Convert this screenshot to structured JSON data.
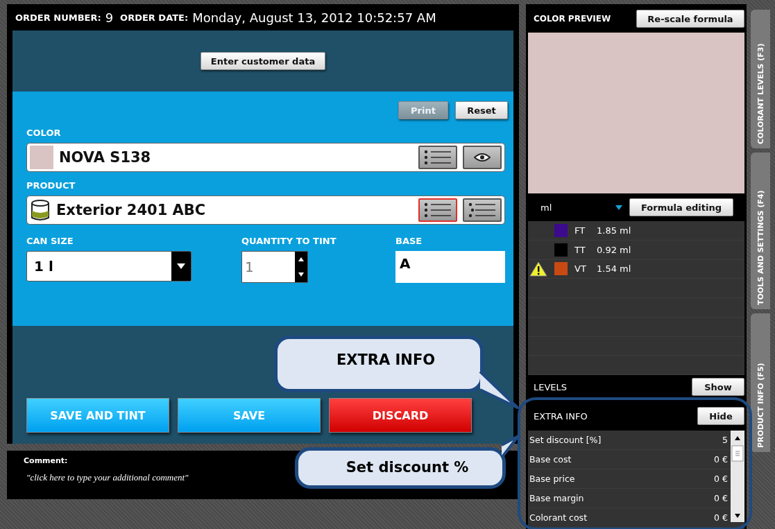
{
  "header": {
    "order_number_label": "ORDER NUMBER:",
    "order_number": "9",
    "order_date_label": "ORDER DATE:",
    "order_date": "Monday, August 13, 2012 10:52:57 AM"
  },
  "customer_button": "Enter customer data",
  "top_buttons": [
    {
      "label": "Print",
      "disabled": true
    },
    {
      "label": "Reset",
      "disabled": false
    }
  ],
  "color": {
    "label": "COLOR",
    "value": "NOVA S138",
    "actions": [
      {
        "kind": "list",
        "highlighted": false
      },
      {
        "kind": "eye",
        "highlighted": false
      }
    ]
  },
  "product": {
    "label": "PRODUCT",
    "value": "Exterior 2401 ABC",
    "actions": [
      {
        "kind": "list",
        "highlighted": true
      },
      {
        "kind": "detail",
        "highlighted": false
      }
    ]
  },
  "can_size": {
    "label": "CAN SIZE",
    "value": "1 l"
  },
  "quantity": {
    "label": "QUANTITY TO TINT",
    "value": "1"
  },
  "base": {
    "label": "BASE",
    "value": "A"
  },
  "actions": [
    {
      "label": "SAVE AND TINT",
      "kind": "primary"
    },
    {
      "label": "SAVE",
      "kind": "primary"
    },
    {
      "label": "DISCARD",
      "kind": "danger"
    }
  ],
  "comment": {
    "label": "Comment:",
    "placeholder": "\"click here to type your additional comment\""
  },
  "preview": {
    "title": "COLOR PREVIEW",
    "button": "Re-scale formula",
    "color": "#d9c4c3"
  },
  "unit": {
    "value": "ml",
    "button": "Formula editing"
  },
  "colorants": [
    {
      "code": "FT",
      "amount": "1.85 ml",
      "color": "#3c0a8c",
      "warning": false
    },
    {
      "code": "TT",
      "amount": "0.92 ml",
      "color": "#000000",
      "warning": false
    },
    {
      "code": "VT",
      "amount": "1.54 ml",
      "color": "#c84a12",
      "warning": true
    }
  ],
  "levels": {
    "label": "LEVELS",
    "button": "Show"
  },
  "extra_info": {
    "label": "EXTRA INFO",
    "button": "Hide",
    "rows": [
      {
        "label": "Set discount [%]",
        "value": "5"
      },
      {
        "label": "Base cost",
        "value": "0 €"
      },
      {
        "label": "Base price",
        "value": "0 €"
      },
      {
        "label": "Base margin",
        "value": "0 €"
      },
      {
        "label": "Colorant cost",
        "value": "0 €"
      }
    ]
  },
  "side_tabs": [
    "COLORANT LEVELS (F3)",
    "TOOLS AND SETTINGS (F4)",
    "PRODUCT INFO (F5)"
  ],
  "callouts": [
    {
      "text": "EXTRA INFO"
    },
    {
      "text": "Set discount %"
    }
  ]
}
